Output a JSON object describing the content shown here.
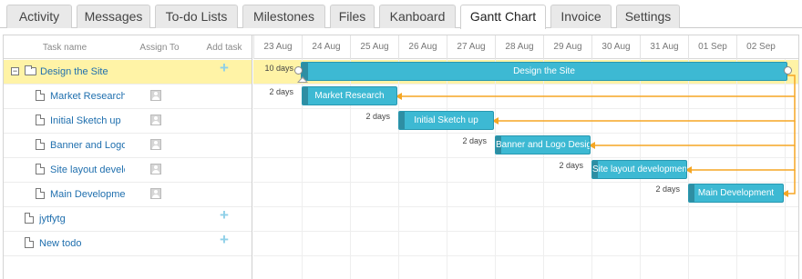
{
  "tabs": [
    "Activity",
    "Messages",
    "To-do Lists",
    "Milestones",
    "Files",
    "Kanboard",
    "Gantt Chart",
    "Invoice",
    "Settings"
  ],
  "active_tab": "Gantt Chart",
  "grid_header": {
    "task_name": "Task name",
    "assign_to": "Assign To",
    "add_task": "Add task"
  },
  "scale_days": [
    "23 Aug",
    "24 Aug",
    "25 Aug",
    "26 Aug",
    "27 Aug",
    "28 Aug",
    "29 Aug",
    "30 Aug",
    "31 Aug",
    "01 Sep",
    "02 Sep"
  ],
  "rows": [
    {
      "name": "Design the Site",
      "type": "project",
      "duration_label": "10 days",
      "bar_text": "Design the Site"
    },
    {
      "name": "Market Research",
      "type": "task",
      "duration_label": "2 days",
      "bar_text": "Market Research"
    },
    {
      "name": "Initial Sketch up",
      "type": "task",
      "duration_label": "2 days",
      "bar_text": "Initial Sketch up"
    },
    {
      "name": "Banner and Logo Design",
      "type": "task",
      "duration_label": "2 days",
      "bar_text": "Banner and Logo Design"
    },
    {
      "name": "Site layout development",
      "type": "task",
      "duration_label": "2 days",
      "bar_text": "Site layout development"
    },
    {
      "name": "Main Development",
      "type": "task",
      "duration_label": "2 days",
      "bar_text": "Main Development"
    },
    {
      "name": "jytfytg",
      "type": "todo"
    },
    {
      "name": "New todo",
      "type": "todo"
    }
  ],
  "colors": {
    "bar": "#3db9d3",
    "highlight": "#fff3a6",
    "link": "#f5a623"
  }
}
